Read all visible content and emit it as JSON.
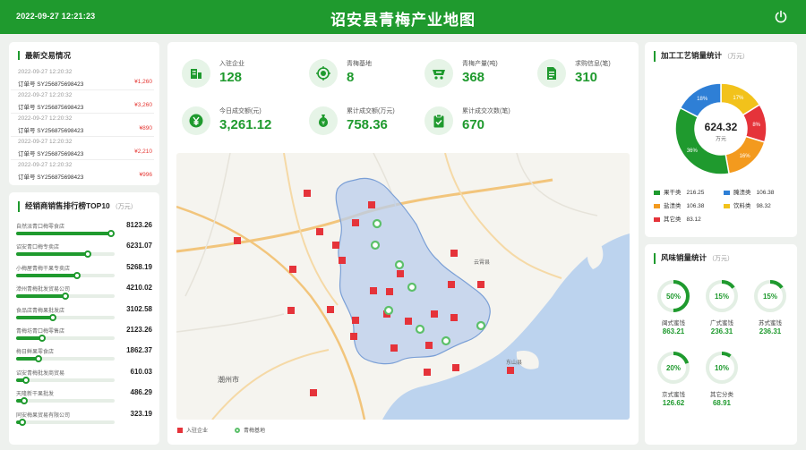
{
  "header": {
    "datetime": "2022-09-27 12:21:23",
    "title": "诏安县青梅产业地图"
  },
  "trades": {
    "title": "最新交易情况",
    "items": [
      {
        "time": "2022-09-27 12:20:32",
        "order": "订单号  SY256875698423",
        "amount": "¥1,260"
      },
      {
        "time": "2022-09-27 12:20:32",
        "order": "订单号  SY256875698423",
        "amount": "¥3,260"
      },
      {
        "time": "2022-09-27 12:20:32",
        "order": "订单号  SY256875698423",
        "amount": "¥890"
      },
      {
        "time": "2022-09-27 12:20:32",
        "order": "订单号  SY256875698423",
        "amount": "¥2,210"
      },
      {
        "time": "2022-09-27 12:20:32",
        "order": "订单号  SY256875698423",
        "amount": "¥996"
      }
    ]
  },
  "ranking": {
    "title": "经销商销售排行榜TOP10",
    "unit": "（万元）",
    "items": [
      {
        "name": "自然派青口梅零食店",
        "value": "8123.26",
        "pct": 0.96
      },
      {
        "name": "诏安青口梅专卖店",
        "value": "6231.07",
        "pct": 0.73
      },
      {
        "name": "小梅屋青梅干果专卖店",
        "value": "5268.19",
        "pct": 0.62
      },
      {
        "name": "漳州青梅批发贸易公司",
        "value": "4210.02",
        "pct": 0.5
      },
      {
        "name": "食品店青梅果批发店",
        "value": "3102.58",
        "pct": 0.37
      },
      {
        "name": "青梅坊青口梅零售店",
        "value": "2123.26",
        "pct": 0.26
      },
      {
        "name": "梅日鲜果零食店",
        "value": "1862.37",
        "pct": 0.23
      },
      {
        "name": "诏安青梅批发商贸易",
        "value": "610.03",
        "pct": 0.1
      },
      {
        "name": "天隆新干果批发",
        "value": "486.29",
        "pct": 0.08
      },
      {
        "name": "同安梅果贸易有限公司",
        "value": "323.19",
        "pct": 0.06
      }
    ]
  },
  "stats": [
    {
      "label": "入驻企业",
      "value": "128",
      "icon": "building-icon"
    },
    {
      "label": "青梅基地",
      "value": "8",
      "icon": "target-icon"
    },
    {
      "label": "青梅产量(吨)",
      "value": "368",
      "icon": "cart-icon"
    },
    {
      "label": "求购信息(笔)",
      "value": "310",
      "icon": "document-icon"
    },
    {
      "label": "今日成交额(元)",
      "value": "3,261.12",
      "icon": "yen-icon"
    },
    {
      "label": "累计成交额(万元)",
      "value": "758.36",
      "icon": "money-bag-icon"
    },
    {
      "label": "累计成交次数(笔)",
      "value": "670",
      "icon": "clipboard-check-icon"
    }
  ],
  "map": {
    "labels": {
      "chaozhou": "潮州市",
      "yunxiao": "云霄县",
      "dongshan": "东山县"
    },
    "legend": {
      "enterprise": "入驻企业",
      "base": "青梅基地"
    }
  },
  "process": {
    "title": "加工工艺销量统计",
    "unit": "（万元）",
    "total": "624.32",
    "total_unit": "万元",
    "slices": [
      {
        "name": "果干类",
        "value": "216.25",
        "pct": "36%",
        "color": "#1f9a2e"
      },
      {
        "name": "腌渍类",
        "value": "106.38",
        "pct": "18%",
        "color": "#2e7fd6"
      },
      {
        "name": "盐渍类",
        "value": "106.38",
        "pct": "16%",
        "color": "#f39a1e"
      },
      {
        "name": "饮料类",
        "value": "98.32",
        "pct": "17%",
        "color": "#f2c21b"
      },
      {
        "name": "其它类",
        "value": "83.12",
        "pct": "8%",
        "color": "#e5333a"
      }
    ]
  },
  "flavor": {
    "title": "风味销量统计",
    "unit": "（万元）",
    "items": [
      {
        "name": "闽式蜜饯",
        "value": "863.21",
        "pct": "50%",
        "frac": 0.5
      },
      {
        "name": "广式蜜饯",
        "value": "236.31",
        "pct": "15%",
        "frac": 0.15
      },
      {
        "name": "苏式蜜饯",
        "value": "236.31",
        "pct": "15%",
        "frac": 0.15
      },
      {
        "name": "京式蜜饯",
        "value": "126.62",
        "pct": "20%",
        "frac": 0.2
      },
      {
        "name": "其它分类",
        "value": "68.91",
        "pct": "10%",
        "frac": 0.1
      }
    ]
  }
}
